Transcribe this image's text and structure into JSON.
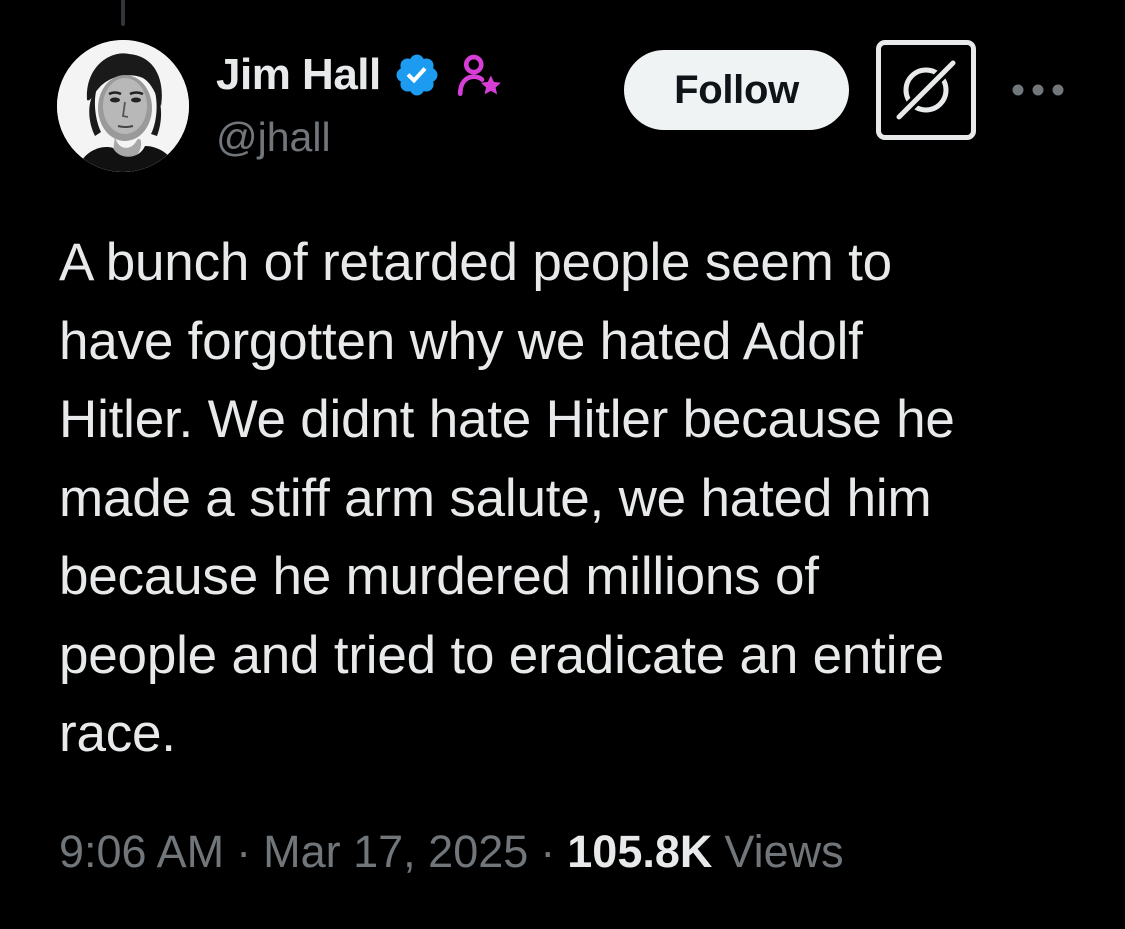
{
  "user": {
    "display_name": "Jim Hall",
    "handle": "@jhall",
    "avatar_icon": "avatar-photo",
    "verified_icon": "verified-badge-icon",
    "affiliate_icon": "affiliate-badge-icon"
  },
  "actions": {
    "follow_label": "Follow",
    "grok_icon": "grok-icon",
    "more_icon": "more-options-icon"
  },
  "tweet": {
    "text": "A bunch of retarded people seem to\nhave forgotten why we hated Adolf\nHitler. We didnt hate Hitler because he\nmade a stiff arm salute, we hated him\nbecause he murdered millions of\npeople and tried to eradicate an entire\nrace."
  },
  "meta": {
    "time": "9:06 AM",
    "separator": "·",
    "date": "Mar 17, 2025",
    "views_count": "105.8K",
    "views_label": "Views"
  },
  "colors": {
    "background": "#000000",
    "primary_text": "#e7e9ea",
    "secondary_text": "#71767b",
    "verified_blue": "#1d9bf0",
    "affiliate_magenta": "#d63ed6",
    "follow_bg": "#eff3f4"
  }
}
